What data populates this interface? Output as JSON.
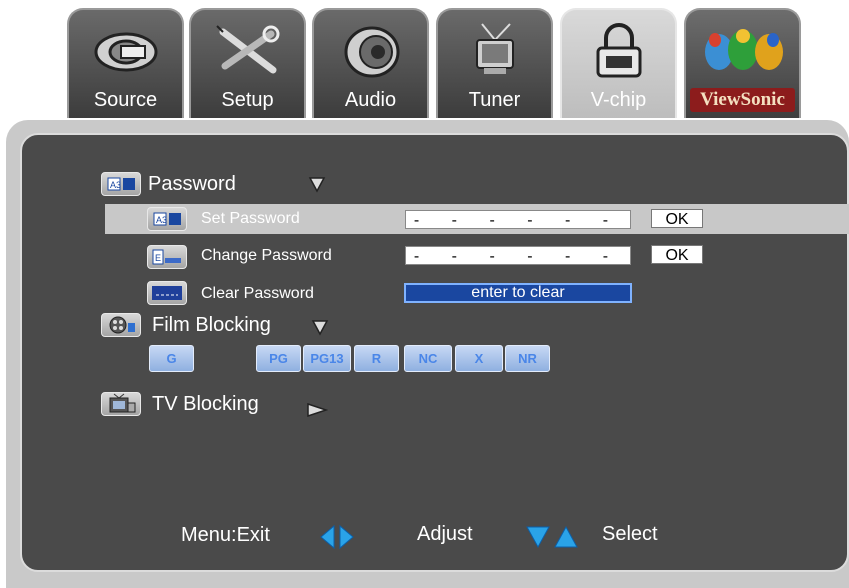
{
  "tabs": [
    {
      "label": "Source",
      "icon": "plug-icon",
      "active": false
    },
    {
      "label": "Setup",
      "icon": "tools-icon",
      "active": false
    },
    {
      "label": "Audio",
      "icon": "speaker-icon",
      "active": false
    },
    {
      "label": "Tuner",
      "icon": "tv-antenna-icon",
      "active": false
    },
    {
      "label": "V-chip",
      "icon": "padlock-icon",
      "active": true
    },
    {
      "label": "ViewSonic",
      "icon": "viewsonic-birds-logo",
      "active": false
    }
  ],
  "password": {
    "title": "Password",
    "set_label": "Set Password",
    "set_value": "- - - - - -",
    "set_ok": "OK",
    "change_label": "Change Password",
    "change_value": "- - - - - -",
    "change_ok": "OK",
    "clear_label": "Clear Password",
    "clear_value": "enter to clear"
  },
  "film": {
    "title": "Film Blocking",
    "ratings": [
      "G",
      "PG",
      "PG13",
      "R",
      "NC",
      "X",
      "NR"
    ]
  },
  "tv": {
    "title": "TV Blocking"
  },
  "footer": {
    "menu": "Menu:Exit",
    "adjust": "Adjust",
    "select": "Select"
  },
  "colors": {
    "panel": "#4a4a4a",
    "highlight_row": "#c8c8c8",
    "clear_field": "#1a47a0",
    "rating_text": "#4a86e8",
    "arrow": "#2aa3e8"
  }
}
